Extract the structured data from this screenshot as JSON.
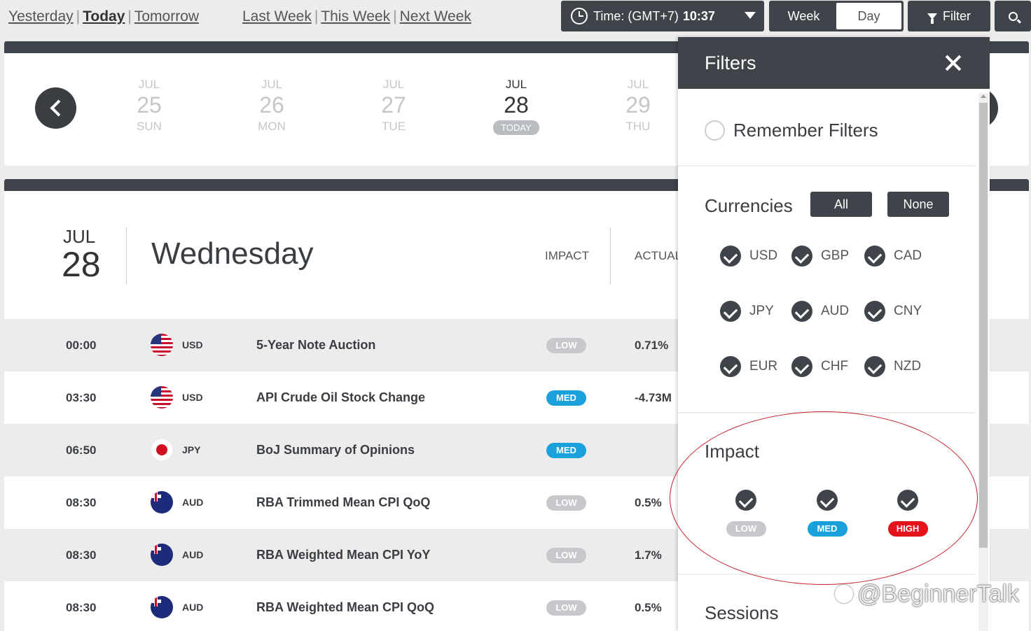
{
  "nav": {
    "day_links": [
      "Yesterday",
      "Today",
      "Tomorrow"
    ],
    "week_links": [
      "Last Week",
      "This Week",
      "Next Week"
    ],
    "time_label": "Time: (GMT+7)",
    "time_value": "10:37",
    "view_week": "Week",
    "view_day": "Day",
    "filter_label": "Filter"
  },
  "datestrip": {
    "days": [
      {
        "month": "JUL",
        "date": "25",
        "weekday": "SUN"
      },
      {
        "month": "JUL",
        "date": "26",
        "weekday": "MON"
      },
      {
        "month": "JUL",
        "date": "27",
        "weekday": "TUE"
      },
      {
        "month": "JUL",
        "date": "28",
        "weekday": "TODAY"
      },
      {
        "month": "JUL",
        "date": "29",
        "weekday": "THU"
      }
    ]
  },
  "calendar": {
    "month": "JUL",
    "date": "28",
    "weekday": "Wednesday",
    "col_impact": "IMPACT",
    "col_actual": "ACTUAL",
    "events": [
      {
        "time": "00:00",
        "currency": "USD",
        "flag": "us",
        "event": "5-Year Note Auction",
        "impact": "LOW",
        "actual": "0.71%"
      },
      {
        "time": "03:30",
        "currency": "USD",
        "flag": "us",
        "event": "API Crude Oil Stock Change",
        "impact": "MED",
        "actual": "-4.73M"
      },
      {
        "time": "06:50",
        "currency": "JPY",
        "flag": "jp",
        "event": "BoJ Summary of Opinions",
        "impact": "MED",
        "actual": ""
      },
      {
        "time": "08:30",
        "currency": "AUD",
        "flag": "au",
        "event": "RBA Trimmed Mean CPI QoQ",
        "impact": "LOW",
        "actual": "0.5%"
      },
      {
        "time": "08:30",
        "currency": "AUD",
        "flag": "au",
        "event": "RBA Weighted Mean CPI YoY",
        "impact": "LOW",
        "actual": "1.7%"
      },
      {
        "time": "08:30",
        "currency": "AUD",
        "flag": "au",
        "event": "RBA Weighted Mean CPI QoQ",
        "impact": "LOW",
        "actual": "0.5%"
      }
    ]
  },
  "filters": {
    "title": "Filters",
    "remember_label": "Remember Filters",
    "currencies_label": "Currencies",
    "all_label": "All",
    "none_label": "None",
    "currencies": [
      "USD",
      "GBP",
      "CAD",
      "JPY",
      "AUD",
      "CNY",
      "EUR",
      "CHF",
      "NZD"
    ],
    "impact_label": "Impact",
    "impacts": [
      "LOW",
      "MED",
      "HIGH"
    ],
    "sessions_label": "Sessions"
  },
  "watermark": "@BeginnerTalk",
  "colors": {
    "dark": "#3f434a",
    "low": "#c6c8cb",
    "med": "#1aa1dc",
    "high": "#e3121b",
    "annotation": "#c7222a"
  }
}
